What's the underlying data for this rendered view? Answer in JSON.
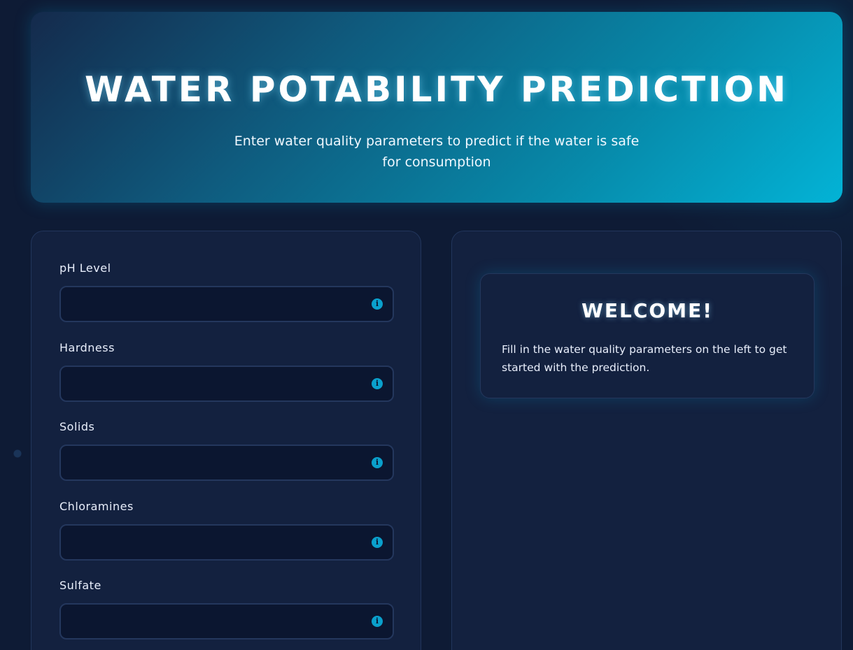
{
  "header": {
    "title": "WATER POTABILITY PREDICTION",
    "subtitle": "Enter water quality parameters to predict if the water is safe for consumption"
  },
  "form": {
    "fields": [
      {
        "label": "pH Level",
        "value": ""
      },
      {
        "label": "Hardness",
        "value": ""
      },
      {
        "label": "Solids",
        "value": ""
      },
      {
        "label": "Chloramines",
        "value": ""
      },
      {
        "label": "Sulfate",
        "value": ""
      }
    ],
    "info_icon": "i"
  },
  "welcome": {
    "title": "WELCOME!",
    "text": "Fill in the water quality parameters on the left to get started with the prediction."
  },
  "colors": {
    "accent": "#03b3d6",
    "background": "#0e1b35",
    "panel": "#13213f"
  }
}
